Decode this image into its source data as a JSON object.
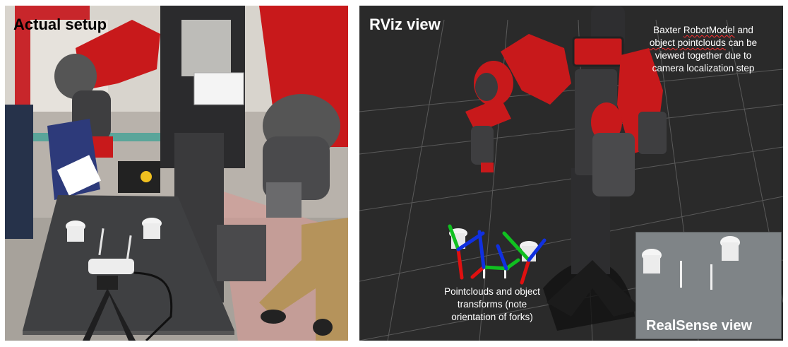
{
  "left_panel": {
    "title": "Actual setup"
  },
  "right_panel": {
    "title": "RViz view",
    "annotation_top": {
      "line1_pre": "Baxter ",
      "line1_underlined": "RobotModel",
      "line1_post": " and",
      "line2_underlined": "object pointclouds",
      "line2_post": " can be",
      "line3": "viewed together due to",
      "line4": "camera localization step"
    },
    "annotation_bottom": {
      "line1": "Pointclouds and object",
      "line2": "transforms (note",
      "line3": "orientation of forks)"
    },
    "inset": {
      "label": "RealSense view"
    }
  },
  "colors": {
    "robot_red": "#c8191b",
    "rviz_background": "#2a2a2a",
    "axis_red": "#e01010",
    "axis_green": "#10c020",
    "axis_blue": "#1030e0"
  }
}
